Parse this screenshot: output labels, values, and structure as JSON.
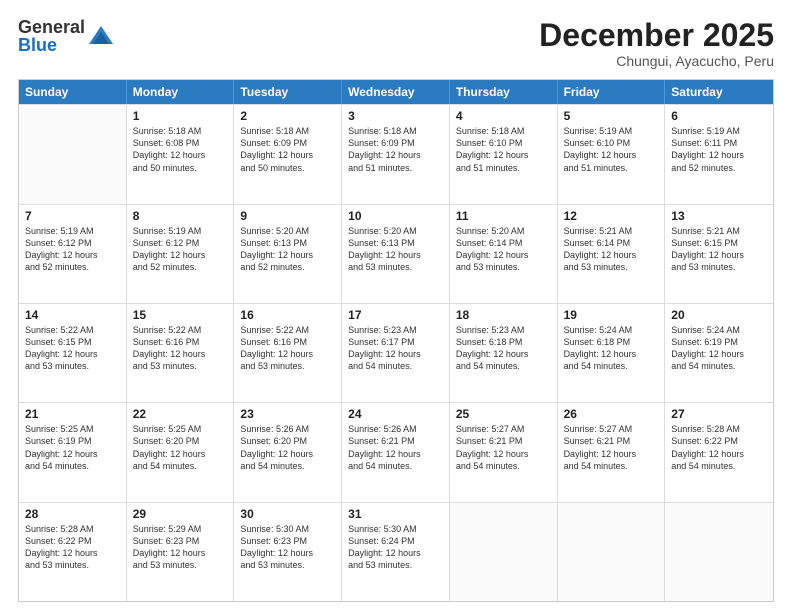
{
  "logo": {
    "general": "General",
    "blue": "Blue"
  },
  "title": "December 2025",
  "location": "Chungui, Ayacucho, Peru",
  "days_of_week": [
    "Sunday",
    "Monday",
    "Tuesday",
    "Wednesday",
    "Thursday",
    "Friday",
    "Saturday"
  ],
  "weeks": [
    [
      {
        "day": "",
        "text": ""
      },
      {
        "day": "1",
        "text": "Sunrise: 5:18 AM\nSunset: 6:08 PM\nDaylight: 12 hours\nand 50 minutes."
      },
      {
        "day": "2",
        "text": "Sunrise: 5:18 AM\nSunset: 6:09 PM\nDaylight: 12 hours\nand 50 minutes."
      },
      {
        "day": "3",
        "text": "Sunrise: 5:18 AM\nSunset: 6:09 PM\nDaylight: 12 hours\nand 51 minutes."
      },
      {
        "day": "4",
        "text": "Sunrise: 5:18 AM\nSunset: 6:10 PM\nDaylight: 12 hours\nand 51 minutes."
      },
      {
        "day": "5",
        "text": "Sunrise: 5:19 AM\nSunset: 6:10 PM\nDaylight: 12 hours\nand 51 minutes."
      },
      {
        "day": "6",
        "text": "Sunrise: 5:19 AM\nSunset: 6:11 PM\nDaylight: 12 hours\nand 52 minutes."
      }
    ],
    [
      {
        "day": "7",
        "text": "Sunrise: 5:19 AM\nSunset: 6:12 PM\nDaylight: 12 hours\nand 52 minutes."
      },
      {
        "day": "8",
        "text": "Sunrise: 5:19 AM\nSunset: 6:12 PM\nDaylight: 12 hours\nand 52 minutes."
      },
      {
        "day": "9",
        "text": "Sunrise: 5:20 AM\nSunset: 6:13 PM\nDaylight: 12 hours\nand 52 minutes."
      },
      {
        "day": "10",
        "text": "Sunrise: 5:20 AM\nSunset: 6:13 PM\nDaylight: 12 hours\nand 53 minutes."
      },
      {
        "day": "11",
        "text": "Sunrise: 5:20 AM\nSunset: 6:14 PM\nDaylight: 12 hours\nand 53 minutes."
      },
      {
        "day": "12",
        "text": "Sunrise: 5:21 AM\nSunset: 6:14 PM\nDaylight: 12 hours\nand 53 minutes."
      },
      {
        "day": "13",
        "text": "Sunrise: 5:21 AM\nSunset: 6:15 PM\nDaylight: 12 hours\nand 53 minutes."
      }
    ],
    [
      {
        "day": "14",
        "text": "Sunrise: 5:22 AM\nSunset: 6:15 PM\nDaylight: 12 hours\nand 53 minutes."
      },
      {
        "day": "15",
        "text": "Sunrise: 5:22 AM\nSunset: 6:16 PM\nDaylight: 12 hours\nand 53 minutes."
      },
      {
        "day": "16",
        "text": "Sunrise: 5:22 AM\nSunset: 6:16 PM\nDaylight: 12 hours\nand 53 minutes."
      },
      {
        "day": "17",
        "text": "Sunrise: 5:23 AM\nSunset: 6:17 PM\nDaylight: 12 hours\nand 54 minutes."
      },
      {
        "day": "18",
        "text": "Sunrise: 5:23 AM\nSunset: 6:18 PM\nDaylight: 12 hours\nand 54 minutes."
      },
      {
        "day": "19",
        "text": "Sunrise: 5:24 AM\nSunset: 6:18 PM\nDaylight: 12 hours\nand 54 minutes."
      },
      {
        "day": "20",
        "text": "Sunrise: 5:24 AM\nSunset: 6:19 PM\nDaylight: 12 hours\nand 54 minutes."
      }
    ],
    [
      {
        "day": "21",
        "text": "Sunrise: 5:25 AM\nSunset: 6:19 PM\nDaylight: 12 hours\nand 54 minutes."
      },
      {
        "day": "22",
        "text": "Sunrise: 5:25 AM\nSunset: 6:20 PM\nDaylight: 12 hours\nand 54 minutes."
      },
      {
        "day": "23",
        "text": "Sunrise: 5:26 AM\nSunset: 6:20 PM\nDaylight: 12 hours\nand 54 minutes."
      },
      {
        "day": "24",
        "text": "Sunrise: 5:26 AM\nSunset: 6:21 PM\nDaylight: 12 hours\nand 54 minutes."
      },
      {
        "day": "25",
        "text": "Sunrise: 5:27 AM\nSunset: 6:21 PM\nDaylight: 12 hours\nand 54 minutes."
      },
      {
        "day": "26",
        "text": "Sunrise: 5:27 AM\nSunset: 6:21 PM\nDaylight: 12 hours\nand 54 minutes."
      },
      {
        "day": "27",
        "text": "Sunrise: 5:28 AM\nSunset: 6:22 PM\nDaylight: 12 hours\nand 54 minutes."
      }
    ],
    [
      {
        "day": "28",
        "text": "Sunrise: 5:28 AM\nSunset: 6:22 PM\nDaylight: 12 hours\nand 53 minutes."
      },
      {
        "day": "29",
        "text": "Sunrise: 5:29 AM\nSunset: 6:23 PM\nDaylight: 12 hours\nand 53 minutes."
      },
      {
        "day": "30",
        "text": "Sunrise: 5:30 AM\nSunset: 6:23 PM\nDaylight: 12 hours\nand 53 minutes."
      },
      {
        "day": "31",
        "text": "Sunrise: 5:30 AM\nSunset: 6:24 PM\nDaylight: 12 hours\nand 53 minutes."
      },
      {
        "day": "",
        "text": ""
      },
      {
        "day": "",
        "text": ""
      },
      {
        "day": "",
        "text": ""
      }
    ]
  ]
}
